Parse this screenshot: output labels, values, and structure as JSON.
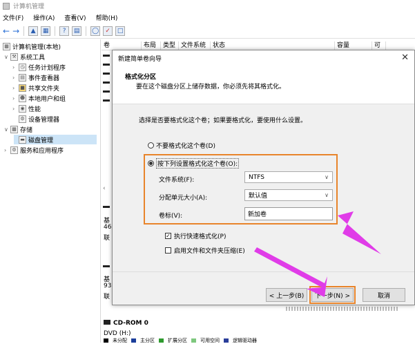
{
  "window": {
    "title": "计算机管理"
  },
  "menu": [
    "文件(F)",
    "操作(A)",
    "查看(V)",
    "帮助(H)"
  ],
  "tree": {
    "root": "计算机管理(本地)",
    "system_tools": "系统工具",
    "task_scheduler": "任务计划程序",
    "event_viewer": "事件查看器",
    "shared_folders": "共享文件夹",
    "local_users": "本地用户和组",
    "performance": "性能",
    "device_manager": "设备管理器",
    "storage": "存储",
    "disk_management": "磁盘管理",
    "services_apps": "服务和应用程序"
  },
  "columns": [
    "卷",
    "布局",
    "类型",
    "文件系统",
    "状态",
    "容量",
    "可"
  ],
  "disks": {
    "d1_a": "基",
    "d1_b": "46",
    "d1_c": "联",
    "d2_a": "基",
    "d2_b": "93",
    "d2_c": "联",
    "cdrom": "CD-ROM 0",
    "dvd": "DVD (H:)"
  },
  "legend": [
    "未分配",
    "主分区",
    "扩展分区",
    "可用空间",
    "逻辑驱动器"
  ],
  "wizard": {
    "title": "新建简单卷向导",
    "header_title": "格式化分区",
    "header_desc": "要在这个磁盘分区上储存数据，你必须先将其格式化。",
    "prompt": "选择是否要格式化这个卷；如果要格式化，要使用什么设置。",
    "opt_no_format": "不要格式化这个卷(D)",
    "opt_format": "按下列设置格式化这个卷(O):",
    "fs_label": "文件系统(F):",
    "fs_value": "NTFS",
    "alloc_label": "分配单元大小(A):",
    "alloc_value": "默认值",
    "vol_label": "卷标(V):",
    "vol_value": "新加卷",
    "quick_format": "执行快速格式化(P)",
    "compress": "启用文件和文件夹压缩(E)",
    "btn_back": "< 上一步(B)",
    "btn_next": "下一步(N) >",
    "btn_cancel": "取消"
  },
  "colors": {
    "highlight": "#e8842a",
    "arrow": "#e03ce8",
    "selection": "#cce4f7"
  }
}
